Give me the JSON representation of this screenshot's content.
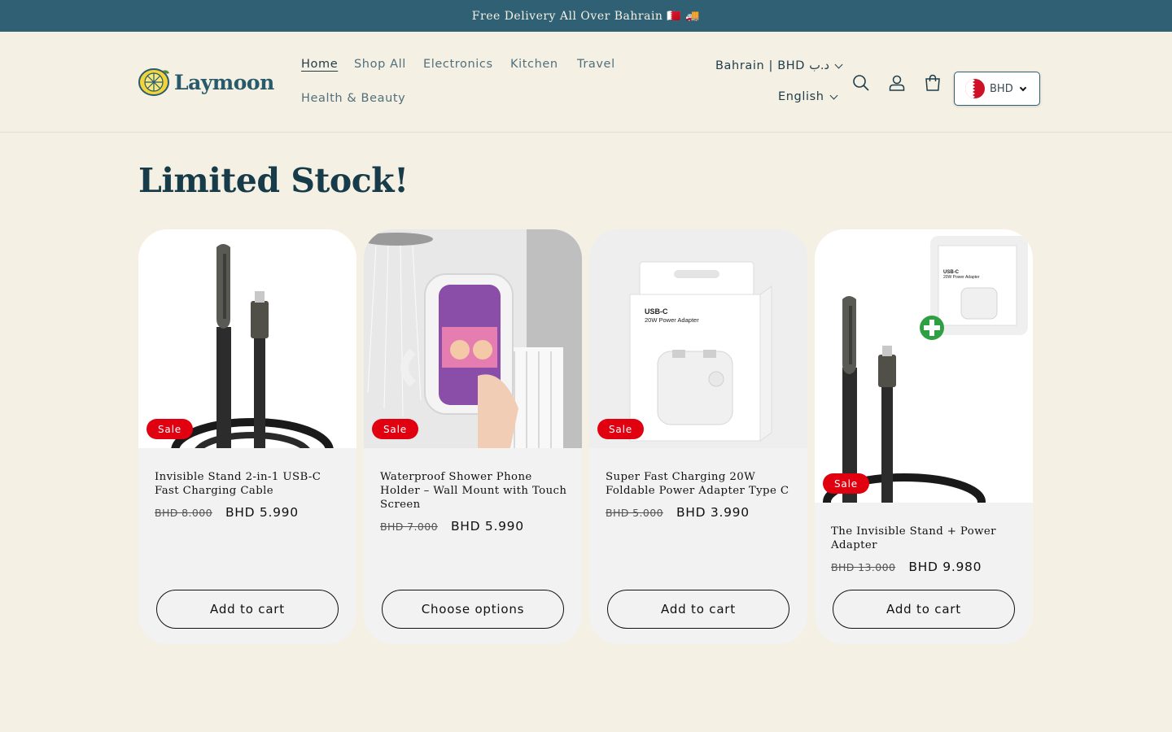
{
  "announcement": "Free Delivery All Over Bahrain 🇧🇭 🚚",
  "brand": {
    "name": "Laymoon"
  },
  "nav": [
    {
      "label": "Home",
      "active": true
    },
    {
      "label": "Shop All"
    },
    {
      "label": "Electronics"
    },
    {
      "label": "Kitchen"
    },
    {
      "label": "Travel"
    },
    {
      "label": "Health & Beauty"
    }
  ],
  "localization": {
    "country": "Bahrain | BHD د.ب",
    "language": "English"
  },
  "currency_selector": {
    "code": "BHD"
  },
  "section": {
    "title": "Limited Stock!"
  },
  "products": [
    {
      "title": "Invisible Stand 2-in-1 USB-C Fast Charging Cable",
      "badge": "Sale",
      "old_price": "BHD 8.000",
      "price": "BHD 5.990",
      "button": "Add to cart"
    },
    {
      "title": "Waterproof Shower Phone Holder – Wall Mount with Touch Screen",
      "badge": "Sale",
      "old_price": "BHD 7.000",
      "price": "BHD 5.990",
      "button": "Choose options"
    },
    {
      "title": "Super Fast Charging 20W Foldable Power Adapter Type C",
      "badge": "Sale",
      "old_price": "BHD 5.000",
      "price": "BHD 3.990",
      "button": "Add to cart",
      "image_text": {
        "line1": "USB-C",
        "line2": "20W Power Adapter"
      }
    },
    {
      "title": "The Invisible Stand + Power Adapter",
      "badge": "Sale",
      "old_price": "BHD 13.000",
      "price": "BHD 9.980",
      "button": "Add to cart",
      "image_text": {
        "line1": "USB-C",
        "line2": "20W Power Adapter"
      }
    }
  ],
  "colors": {
    "announcement_bg": "#2f6074",
    "page_bg": "#f4f0e4",
    "sale_badge": "#e0000f",
    "heading": "#173b48"
  }
}
